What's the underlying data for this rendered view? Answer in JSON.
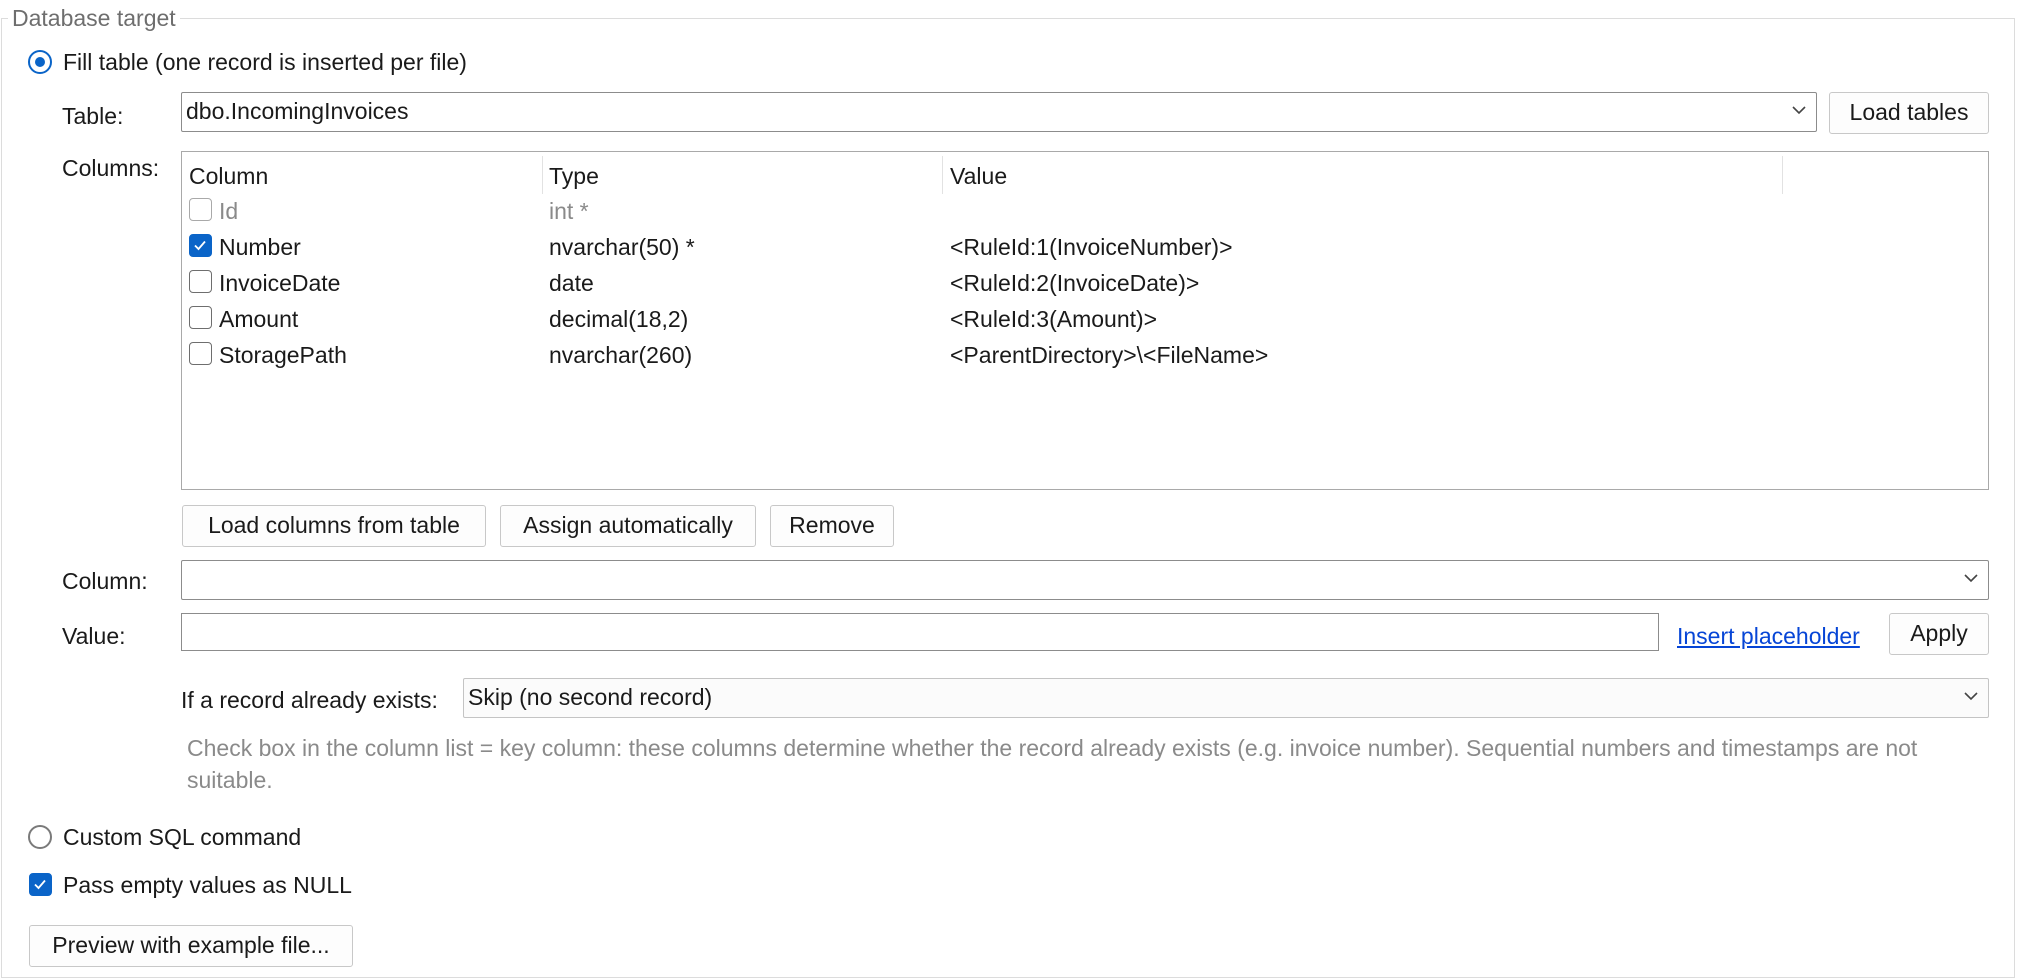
{
  "group": {
    "title": "Database target"
  },
  "mode_fill": {
    "label": "Fill table (one record is inserted per file)",
    "checked": true
  },
  "table_row": {
    "label": "Table:",
    "value": "dbo.IncomingInvoices",
    "load_label": "Load tables"
  },
  "columns_label": "Columns:",
  "column_headers": {
    "column": "Column",
    "type": "Type",
    "value": "Value"
  },
  "rows": [
    {
      "name": "Id",
      "type": "int *",
      "value": "",
      "checked": false,
      "disabled": true
    },
    {
      "name": "Number",
      "type": "nvarchar(50) *",
      "value": "<RuleId:1(InvoiceNumber)>",
      "checked": true,
      "disabled": false
    },
    {
      "name": "InvoiceDate",
      "type": "date",
      "value": "<RuleId:2(InvoiceDate)>",
      "checked": false,
      "disabled": false
    },
    {
      "name": "Amount",
      "type": "decimal(18,2)",
      "value": "<RuleId:3(Amount)>",
      "checked": false,
      "disabled": false
    },
    {
      "name": "StoragePath",
      "type": "nvarchar(260)",
      "value": "<ParentDirectory>\\<FileName>",
      "checked": false,
      "disabled": false
    }
  ],
  "column_buttons": {
    "load_columns": "Load columns from table",
    "assign_auto": "Assign automatically",
    "remove": "Remove"
  },
  "column_field": {
    "label": "Column:",
    "value": ""
  },
  "value_field": {
    "label": "Value:",
    "value": "",
    "insert_placeholder": "Insert placeholder",
    "apply": "Apply"
  },
  "exists": {
    "label": "If a record already exists:",
    "value": "Skip (no second record)"
  },
  "hint": "Check box in the column list = key column: these columns determine whether the record already exists (e.g. invoice number). Sequential numbers and timestamps are not suitable.",
  "mode_sql": {
    "label": "Custom SQL command",
    "checked": false
  },
  "pass_null": {
    "label": "Pass empty values as NULL",
    "checked": true
  },
  "preview_button": "Preview with example file...",
  "colors": {
    "accent": "#0a64c8",
    "link": "#0645d6",
    "muted": "#8a8a8a"
  }
}
